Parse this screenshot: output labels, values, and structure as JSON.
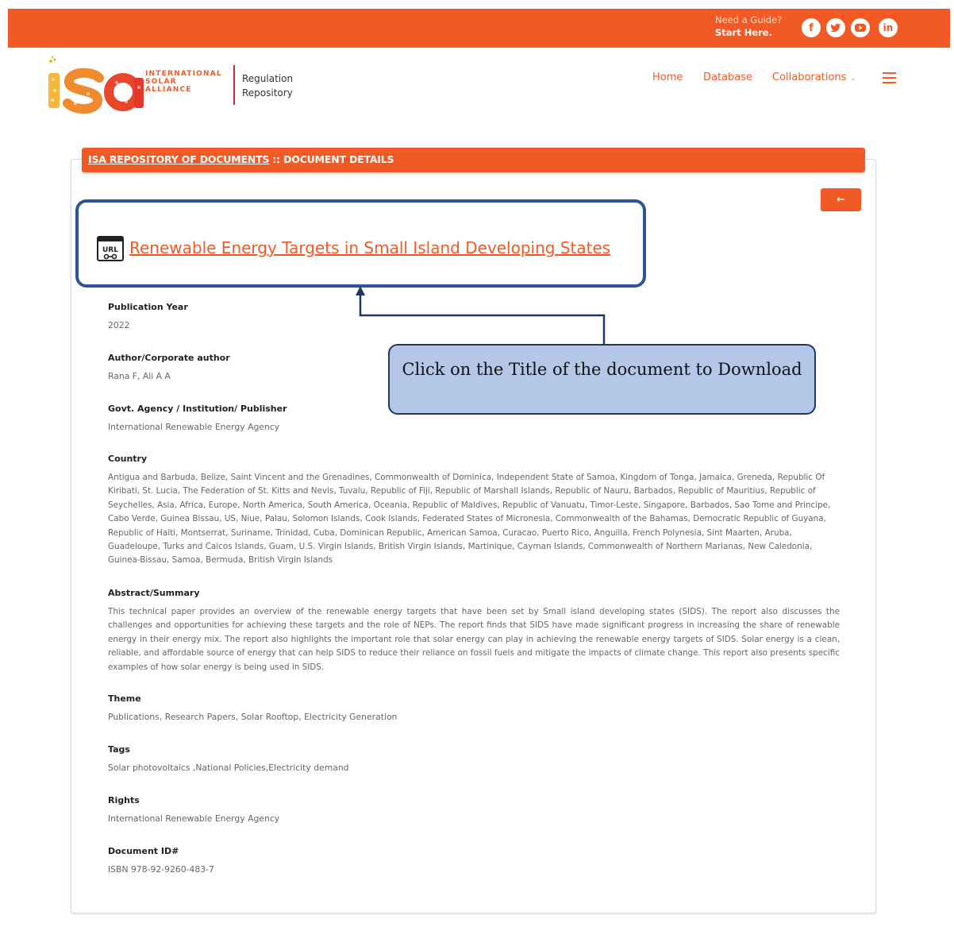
{
  "header": {
    "guide_question": "Need a Guide?",
    "guide_link": "Start Here.",
    "social_icons": [
      "facebook-icon",
      "twitter-icon",
      "youtube-icon",
      "linkedin-icon"
    ],
    "brand_color": "#f15a24"
  },
  "logo": {
    "name_line1": "INTERNATIONAL",
    "name_line2": "SOLAR",
    "name_line3": "ALLIANCE",
    "product_line1": "Regulation",
    "product_line2": "Repository"
  },
  "nav": {
    "home": "Home",
    "database": "Database",
    "collaborations": "Collaborations",
    "collaborations_caret": "⌄"
  },
  "breadcrumb": {
    "link": "ISA REPOSITORY OF DOCUMENTS",
    "sep": " :: ",
    "current": "DOCUMENT DETAILS"
  },
  "back_button": "←",
  "document": {
    "title": "Renewable Energy Targets in Small Island Developing States",
    "icon_text": "URL",
    "fields": {
      "pub_year_label": "Publication Year",
      "pub_year": "2022",
      "author_label": "Author/Corporate author",
      "author": "Rana F, Ali A A",
      "publisher_label": "Govt. Agency / Institution/ Publisher",
      "publisher": "International Renewable Energy Agency",
      "country_label": "Country",
      "country": "Antigua and Barbuda, Belize, Saint Vincent and the Grenadines, Commonwealth of Dominica, Independent State of Samoa, Kingdom of Tonga, Jamaica, Greneda, Republic Of Kiribati, St. Lucia, The Federation of St. Kitts and Nevis, Tuvalu, Republic of Fiji, Republic of Marshall Islands, Republic of Nauru, Barbados, Republic of Mauritius, Republic of Seychelles, Asia, Africa, Europe, North America, South America, Oceania, Republic of Maldives, Republic of Vanuatu, Timor-Leste, Singapore, Barbados, Sao Tome and Principe, Cabo Verde, Guinea Bissau, US, Niue, Palau, Solomon Islands, Cook Islands, Federated States of Micronesia, Commonwealth of the Bahamas, Democratic Republic of Guyana, Republic of Haiti, Montserrat, Suriname, Trinidad, Cuba, Dominican Republic, American Samoa, Curacao, Puerto Rico, Anguilla, French Polynesia, Sint Maarten, Aruba, Guadeloupe, Turks and Caicos Islands, Guam, U.S. Virgin Islands, British Virgin Islands, Martinique, Cayman Islands, Commonwealth of Northern Marianas, New Caledonia, Guinea-Bissau, Samoa, Bermuda, British Virgin Islands",
      "abstract_label": "Abstract/Summary",
      "abstract": "This technical paper provides an overview of the renewable energy targets that have been set by Small island developing states (SIDS). The report also discusses the challenges and opportunities for achieving these targets and the role of NEPs. The report finds that SIDS have made significant progress in increasing the share of renewable energy in their energy mix.  The report also highlights the important role that solar energy can play in achieving the renewable energy targets of SIDS. Solar energy is a clean, reliable, and affordable source of energy that can help SIDS to reduce their reliance on fossil fuels and mitigate the impacts of climate change. This report also presents specific examples of how solar energy is being used in SIDS.",
      "theme_label": "Theme",
      "theme": "Publications, Research Papers, Solar Rooftop, Electricity Generation",
      "tags_label": "Tags",
      "tags": "Solar photovoltaics ,National Policies,Electricity demand",
      "rights_label": "Rights",
      "rights": "International Renewable Energy Agency",
      "docid_label": "Document ID#",
      "docid": "ISBN 978-92-9260-483-7"
    }
  },
  "annotation": {
    "callout_text": "Click on the Title of the document to Download",
    "box_color": "#2f5496",
    "callout_fill": "#b4c7e7"
  }
}
